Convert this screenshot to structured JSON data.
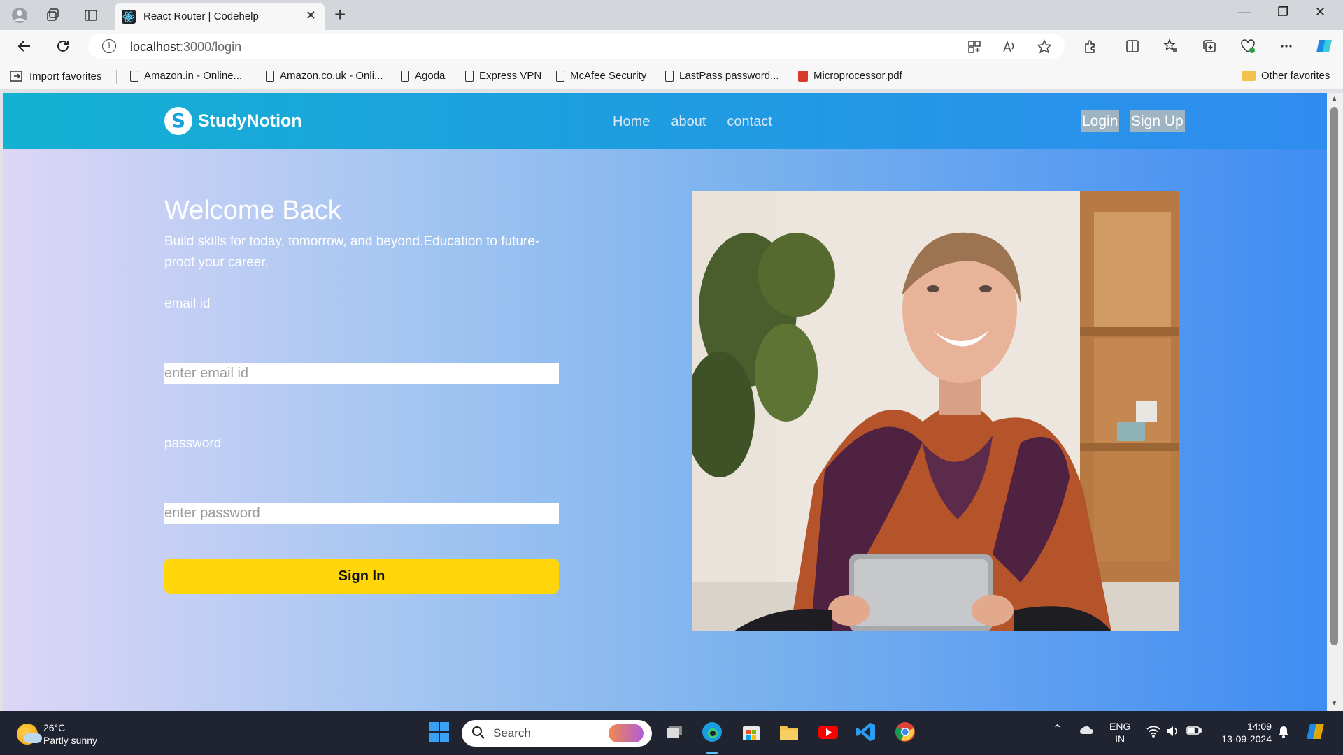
{
  "browser": {
    "tab_title": "React Router | Codehelp",
    "url_host": "localhost",
    "url_rest": ":3000/login",
    "favorites": [
      {
        "label": "Import favorites",
        "icon": "import-icon"
      },
      {
        "label": "Amazon.in - Online...",
        "icon": "document-icon"
      },
      {
        "label": "Amazon.co.uk - Onli...",
        "icon": "document-icon"
      },
      {
        "label": "Agoda",
        "icon": "document-icon"
      },
      {
        "label": "Express VPN",
        "icon": "document-icon"
      },
      {
        "label": "McAfee Security",
        "icon": "document-icon"
      },
      {
        "label": "LastPass password...",
        "icon": "document-icon"
      },
      {
        "label": "Microprocessor.pdf",
        "icon": "pdf-icon"
      }
    ],
    "other_favorites": "Other favorites"
  },
  "app": {
    "logo_letter": "S",
    "logo_text": "StudyNotion",
    "nav": [
      "Home",
      "about",
      "contact"
    ],
    "login_label": "Login",
    "signup_label": "Sign Up",
    "colors": {
      "header_start": "#14b1d2",
      "header_end": "#2f8cef",
      "button": "#ffd60a"
    }
  },
  "login": {
    "title": "Welcome Back",
    "tagline": "Build skills for today, tomorrow, and beyond.Education to future-proof your career.",
    "email_label": "email id",
    "email_placeholder": "enter email id",
    "password_label": "password",
    "password_placeholder": "enter password",
    "submit_label": "Sign In"
  },
  "taskbar": {
    "temperature": "26°C",
    "weather": "Partly sunny",
    "search_label": "Search",
    "lang_1": "ENG",
    "lang_2": "IN",
    "time": "14:09",
    "date": "13-09-2024"
  }
}
